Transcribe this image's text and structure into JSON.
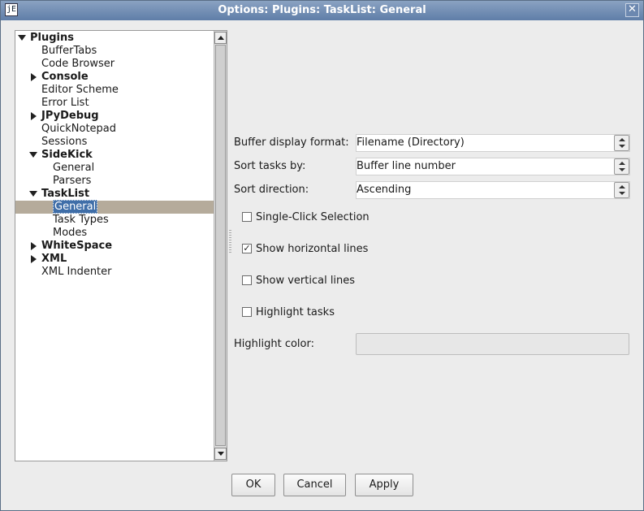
{
  "window": {
    "title": "Options: Plugins: TaskList: General",
    "icon_text": "jE",
    "close_glyph": "✕"
  },
  "tree": {
    "items": [
      {
        "label": "Plugins",
        "bold": true,
        "expander": "open"
      },
      {
        "label": "BufferTabs"
      },
      {
        "label": "Code Browser"
      },
      {
        "label": "Console",
        "bold": true,
        "expander": "closed"
      },
      {
        "label": "Editor Scheme"
      },
      {
        "label": "Error List"
      },
      {
        "label": "JPyDebug",
        "bold": true,
        "expander": "closed"
      },
      {
        "label": "QuickNotepad"
      },
      {
        "label": "Sessions"
      },
      {
        "label": "SideKick",
        "bold": true,
        "expander": "open"
      },
      {
        "label": "General"
      },
      {
        "label": "Parsers"
      },
      {
        "label": "TaskList",
        "bold": true,
        "expander": "open"
      },
      {
        "label": "General",
        "selected": true
      },
      {
        "label": "Task Types"
      },
      {
        "label": "Modes"
      },
      {
        "label": "WhiteSpace",
        "bold": true,
        "expander": "closed"
      },
      {
        "label": "XML",
        "bold": true,
        "expander": "closed"
      },
      {
        "label": "XML Indenter"
      }
    ]
  },
  "form": {
    "buffer_display_format": {
      "label": "Buffer display format:",
      "value": "Filename (Directory)"
    },
    "sort_tasks_by": {
      "label": "Sort tasks by:",
      "value": "Buffer line number"
    },
    "sort_direction": {
      "label": "Sort direction:",
      "value": "Ascending"
    },
    "single_click": {
      "label": "Single-Click Selection",
      "checked": false
    },
    "horizontal_lines": {
      "label": "Show horizontal lines",
      "checked": true
    },
    "vertical_lines": {
      "label": "Show vertical lines",
      "checked": false
    },
    "highlight_tasks": {
      "label": "Highlight tasks",
      "checked": false
    },
    "highlight_color": {
      "label": "Highlight color:",
      "color": "#e7e7e7"
    }
  },
  "buttons": {
    "ok": "OK",
    "cancel": "Cancel",
    "apply": "Apply"
  }
}
